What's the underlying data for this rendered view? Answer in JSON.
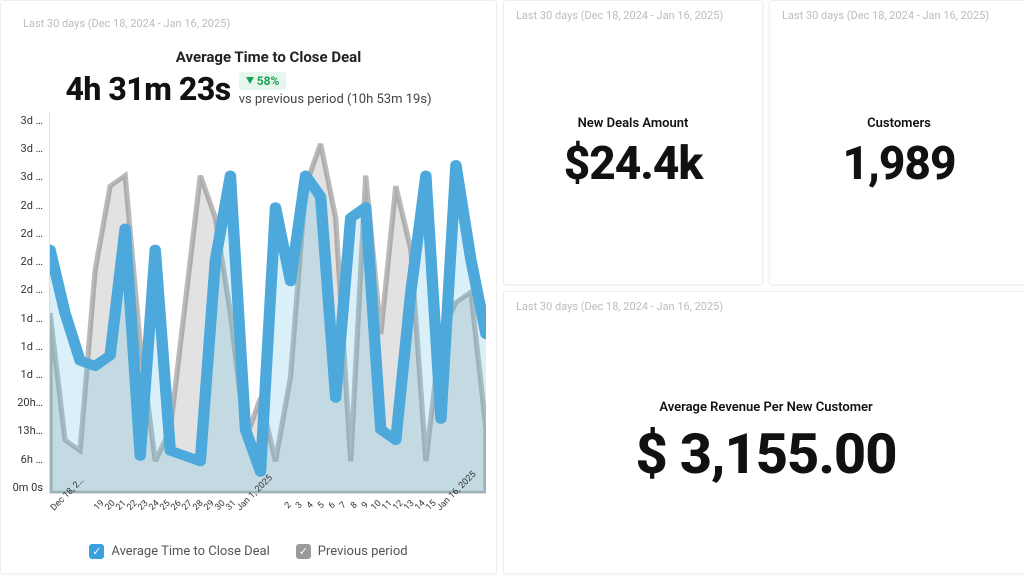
{
  "date_range": "Last 30 days (Dec 18, 2024 - Jan 16, 2025)",
  "chart": {
    "title": "Average Time to Close Deal",
    "big_value": "4h 31m 23s",
    "delta": "58%",
    "vs_text": "vs previous period (10h 53m 19s)",
    "legend": {
      "current": "Average Time to Close Deal",
      "previous": "Previous period"
    }
  },
  "kpis": {
    "new_deals": {
      "label": "New Deals Amount",
      "value": "$24.4k"
    },
    "customers": {
      "label": "Customers",
      "value": "1,989"
    },
    "avg_rev": {
      "label": "Average Revenue Per New Customer",
      "value": "$ 3,155.00"
    }
  },
  "chart_data": {
    "type": "area",
    "title": "Average Time to Close Deal",
    "xlabel": "",
    "ylabel": "",
    "ylim_hours": [
      0,
      72
    ],
    "y_ticks": [
      "3d …",
      "3d …",
      "3d …",
      "2d …",
      "2d …",
      "2d …",
      "2d …",
      "1d …",
      "1d …",
      "1d …",
      "20h…",
      "13h…",
      "6h …",
      "0m 0s"
    ],
    "categories": [
      "Dec 18, 2…",
      "19",
      "20",
      "21",
      "22",
      "23",
      "24",
      "25",
      "26",
      "27",
      "28",
      "29",
      "30",
      "31",
      "Jan 1, 2025",
      "2",
      "3",
      "4",
      "5",
      "6",
      "7",
      "8",
      "9",
      "10",
      "11",
      "12",
      "13",
      "14",
      "15",
      "Jan 16, 2025"
    ],
    "series": [
      {
        "name": "Average Time to Close Deal",
        "color": "#4da9db",
        "values_hours": [
          46,
          34,
          25,
          24,
          26,
          50,
          7,
          46,
          8,
          7,
          6,
          44,
          60,
          12,
          4,
          54,
          40,
          60,
          56,
          18,
          52,
          54,
          12,
          10,
          38,
          60,
          14,
          62,
          44,
          30
        ]
      },
      {
        "name": "Previous period",
        "color": "#9a9a9a",
        "values_hours": [
          34,
          10,
          8,
          42,
          58,
          60,
          28,
          6,
          12,
          36,
          60,
          52,
          34,
          10,
          18,
          6,
          22,
          58,
          66,
          52,
          6,
          60,
          30,
          58,
          46,
          6,
          30,
          36,
          38,
          12
        ]
      }
    ]
  }
}
